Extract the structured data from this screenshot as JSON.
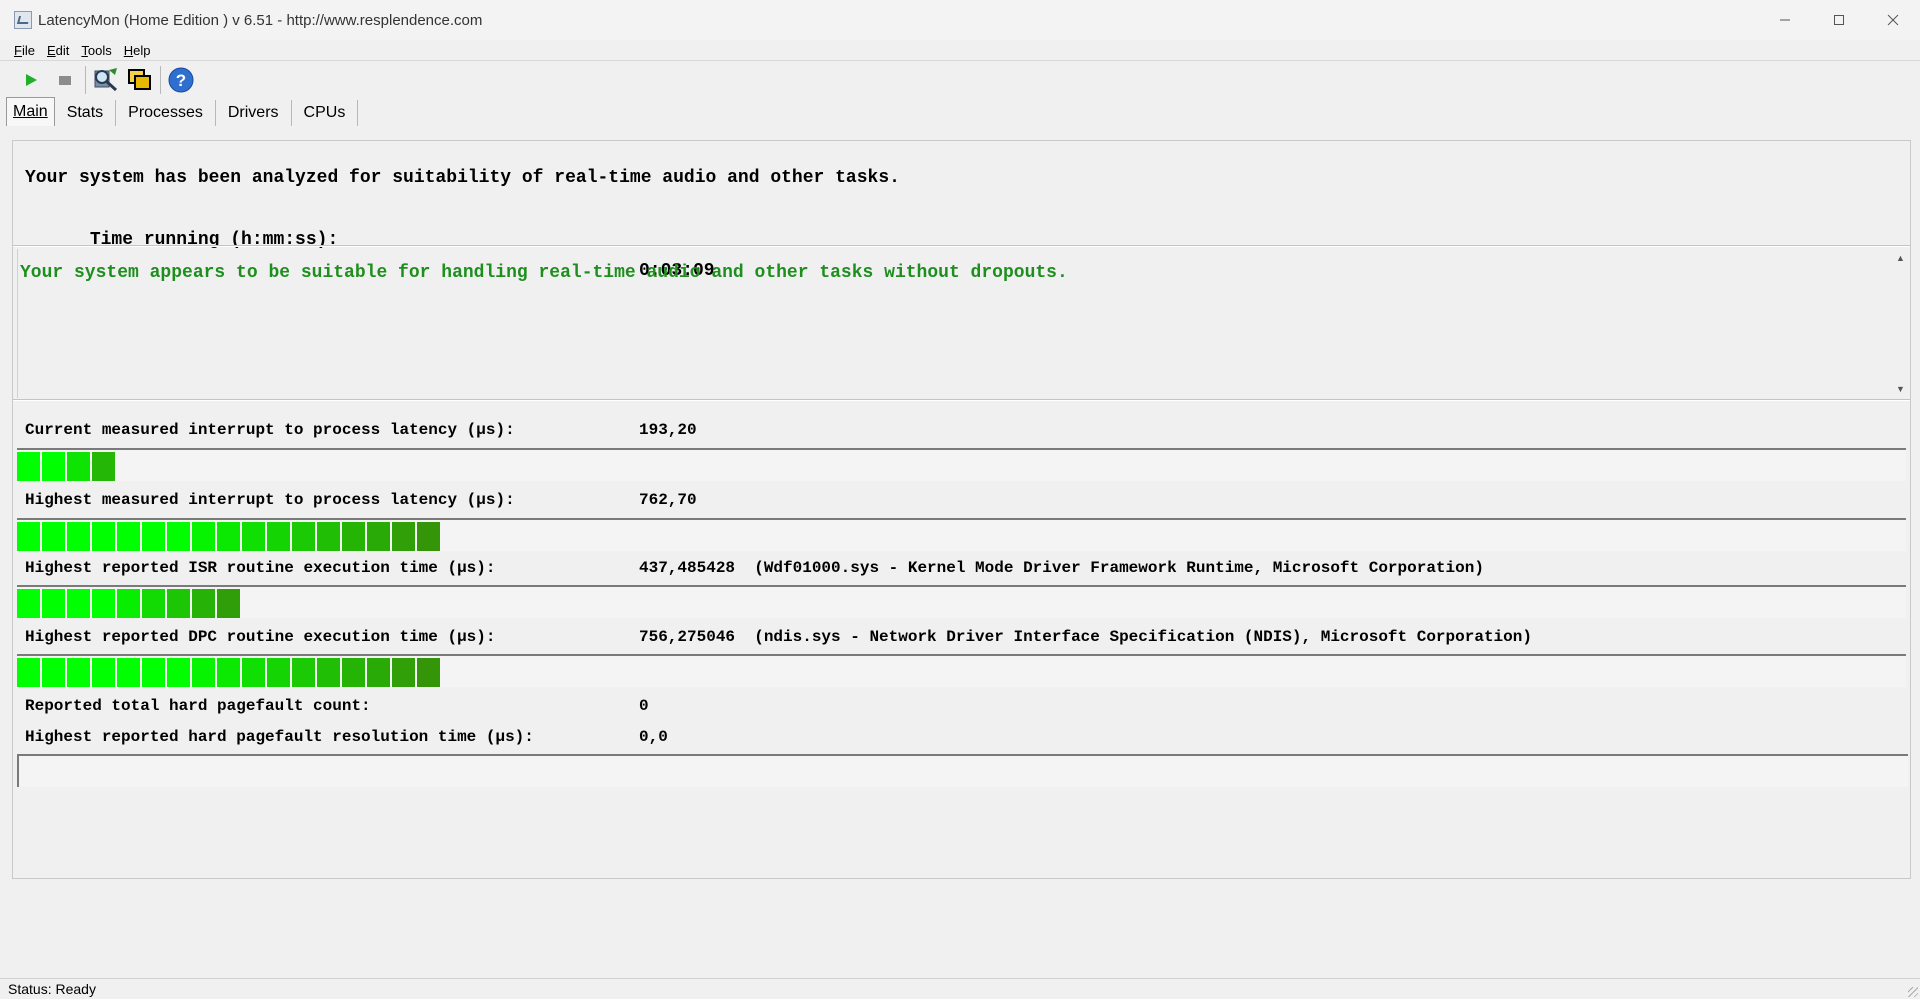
{
  "window": {
    "title": "LatencyMon  (Home Edition )  v 6.51 - http://www.resplendence.com"
  },
  "menu": [
    {
      "accel": "F",
      "rest": "ile"
    },
    {
      "accel": "E",
      "rest": "dit"
    },
    {
      "accel": "T",
      "rest": "ools"
    },
    {
      "accel": "H",
      "rest": "elp"
    }
  ],
  "toolbar": {
    "icons": [
      "play-icon",
      "stop-icon",
      "driver-search-icon",
      "cpu-windows-icon",
      "help-icon"
    ]
  },
  "tabs": [
    "Main",
    "Stats",
    "Processes",
    "Drivers",
    "CPUs"
  ],
  "summary": {
    "line1": "Your system has been analyzed for suitability of real-time audio and other tasks.",
    "time_label": "Time running (h:mm:ss):",
    "time_value": "0:03:09"
  },
  "verdict": {
    "text": "Your system appears to be suitable for handling real-time audio and other tasks without dropouts.",
    "color": "#1e8f1e"
  },
  "metrics": [
    {
      "label": "Current measured interrupt to process latency (µs):",
      "value": "193,20",
      "segments": 4
    },
    {
      "label": "Highest measured interrupt to process latency (µs):",
      "value": "762,70",
      "segments": 17
    },
    {
      "label": "Highest reported ISR routine execution time (µs):",
      "value": "437,485428  (Wdf01000.sys - Kernel Mode Driver Framework Runtime, Microsoft Corporation)",
      "segments": 9
    },
    {
      "label": "Highest reported DPC routine execution time (µs):",
      "value": "756,275046  (ndis.sys - Network Driver Interface Specification (NDIS), Microsoft Corporation)",
      "segments": 17
    },
    {
      "label": "Reported total hard pagefault count:",
      "value": "0"
    },
    {
      "label": "Highest reported hard pagefault resolution time (µs):",
      "value": "0,0",
      "segments": 0
    }
  ],
  "bar_colors": {
    "light": "#00ff00",
    "dark": "#3a8a0a"
  },
  "status": "Status: Ready"
}
